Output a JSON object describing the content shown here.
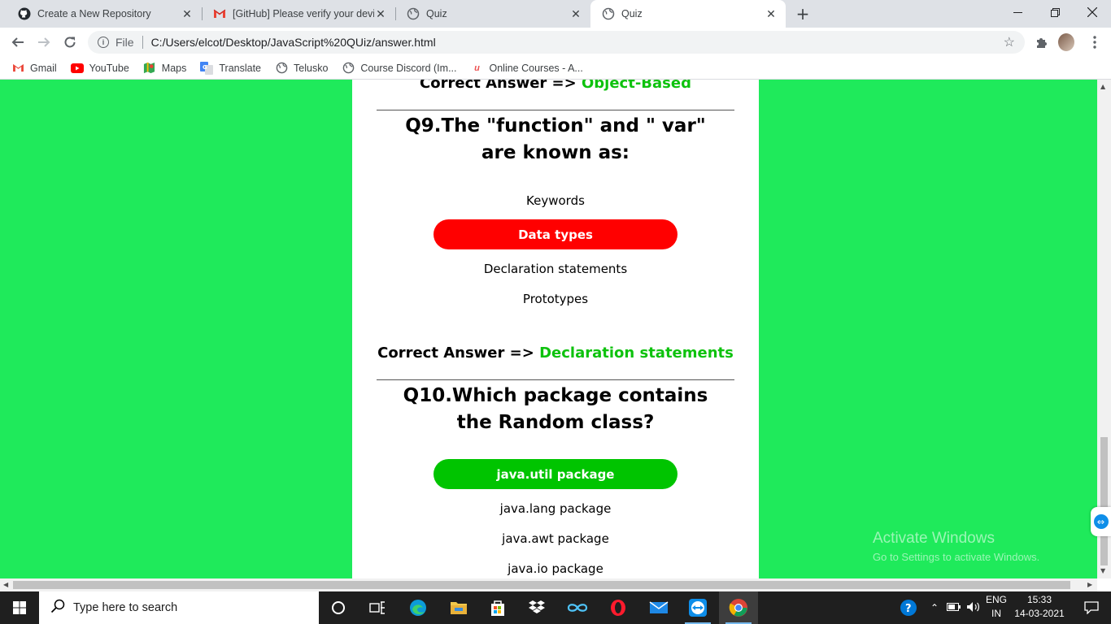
{
  "browser": {
    "tabs": [
      {
        "title": "Create a New Repository",
        "icon": "github-icon",
        "active": false
      },
      {
        "title": "[GitHub] Please verify your device",
        "icon": "gmail-icon",
        "active": false
      },
      {
        "title": "Quiz",
        "icon": "globe-icon",
        "active": false
      },
      {
        "title": "Quiz",
        "icon": "globe-icon",
        "active": true
      }
    ],
    "address": {
      "scheme": "File",
      "url": "C:/Users/elcot/Desktop/JavaScript%20QUiz/answer.html"
    },
    "bookmarks": [
      {
        "label": "Gmail",
        "icon": "gmail-icon"
      },
      {
        "label": "YouTube",
        "icon": "youtube-icon"
      },
      {
        "label": "Maps",
        "icon": "maps-icon"
      },
      {
        "label": "Translate",
        "icon": "translate-icon"
      },
      {
        "label": "Telusko",
        "icon": "globe-icon"
      },
      {
        "label": "Course Discord (Im...",
        "icon": "globe-icon"
      },
      {
        "label": "Online Courses - A...",
        "icon": "udemy-icon"
      }
    ]
  },
  "quiz": {
    "prev_answer": {
      "prefix": "Correct Answer => ",
      "value": "Object-Based"
    },
    "questions": [
      {
        "title": "Q9.The \"function\" and \" var\" are known as:",
        "options": [
          "Keywords",
          "Data types",
          "Declaration statements",
          "Prototypes"
        ],
        "selected_wrong": "Data types",
        "answer_prefix": "Correct Answer => ",
        "answer": "Declaration statements"
      },
      {
        "title": "Q10.Which package contains the Random class?",
        "options": [
          "java.util package",
          "java.lang package",
          "java.awt package",
          "java.io package"
        ],
        "selected_right": "java.util package"
      }
    ],
    "colors": {
      "page_bg": "#1fea5b",
      "correct": "#00c400",
      "wrong": "#ff0000",
      "answer_text": "#0ec20e"
    }
  },
  "watermark": {
    "line1": "Activate Windows",
    "line2": "Go to Settings to activate Windows."
  },
  "taskbar": {
    "search_placeholder": "Type here to search",
    "language": {
      "line1": "ENG",
      "line2": "IN"
    },
    "time": "15:33",
    "date": "14-03-2021"
  }
}
